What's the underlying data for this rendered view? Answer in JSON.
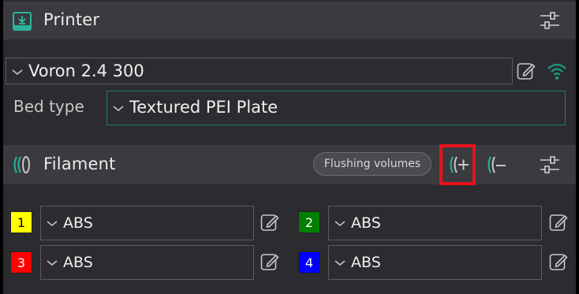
{
  "printer": {
    "title": "Printer",
    "selected_printer": "Voron 2.4 300",
    "bed_type_label": "Bed type",
    "bed_type_value": "Textured PEI Plate"
  },
  "filament": {
    "title": "Filament",
    "flushing_volumes_label": "Flushing volumes",
    "slots": [
      {
        "number": "1",
        "material": "ABS",
        "color": "#ffff00",
        "text_color": "#000000"
      },
      {
        "number": "2",
        "material": "ABS",
        "color": "#008000",
        "text_color": "#ffffff"
      },
      {
        "number": "3",
        "material": "ABS",
        "color": "#ff0000",
        "text_color": "#ffffff"
      },
      {
        "number": "4",
        "material": "ABS",
        "color": "#0000ff",
        "text_color": "#ffffff"
      }
    ]
  },
  "colors": {
    "accent": "#1f9e87",
    "highlight": "#e8121a",
    "wifi": "#16a085"
  },
  "icons": {
    "printer": "printer-icon",
    "settings": "settings-sliders-icon",
    "edit": "edit-pencil-icon",
    "wifi": "wifi-icon",
    "filament": "filament-spool-icon",
    "add_filament": "add-filament-icon",
    "remove_filament": "remove-filament-icon",
    "chevron": "chevron-down-icon"
  }
}
